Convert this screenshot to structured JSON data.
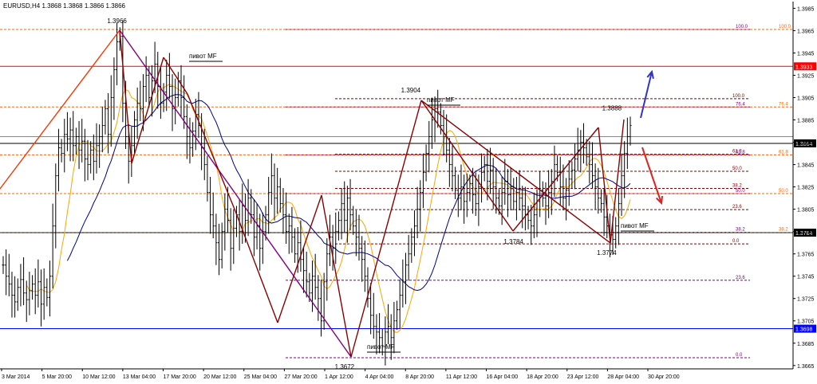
{
  "title": "EURUSD,H4  1.3868 1.3868 1.3866 1.3866",
  "chart_data": {
    "type": "line",
    "symbol": "EURUSD",
    "timeframe": "H4",
    "ohlc_header": [
      1.3868,
      1.3868,
      1.3866,
      1.3866
    ],
    "ylim": [
      1.3662,
      1.3991
    ],
    "y_ticks": [
      1.3985,
      1.3965,
      1.3945,
      1.3925,
      1.3905,
      1.3885,
      1.3865,
      1.3845,
      1.3825,
      1.3805,
      1.3785,
      1.3765,
      1.3745,
      1.3725,
      1.3705,
      1.3685,
      1.3665
    ],
    "x_ticks": [
      "3 Mar 2014",
      "5 Mar 20:00",
      "10 Mar 12:00",
      "13 Mar 04:00",
      "17 Mar 20:00",
      "20 Mar 12:00",
      "25 Mar 04:00",
      "27 Mar 20:00",
      "1 Apr 12:00",
      "4 Apr 04:00",
      "8 Apr 20:00",
      "11 Apr 12:00",
      "16 Apr 04:00",
      "18 Apr 20:00",
      "23 Apr 12:00",
      "28 Apr 04:00",
      "30 Apr 20:00"
    ],
    "price_series": {
      "name": "",
      "color": "#000000",
      "x": [
        0,
        1,
        2,
        3,
        4,
        5,
        6,
        7,
        8,
        9,
        10,
        11,
        12,
        13,
        14,
        15,
        16,
        17,
        18,
        19,
        20,
        21,
        22,
        23,
        24,
        25,
        26,
        27,
        28,
        29,
        30,
        31,
        32,
        33,
        34,
        35,
        36,
        37,
        38,
        39,
        40,
        41,
        42,
        43,
        44,
        45,
        46,
        47,
        48,
        49,
        50,
        51,
        52,
        53,
        54,
        55,
        56,
        57,
        58,
        59,
        60,
        61,
        62,
        63,
        64,
        65,
        66,
        67,
        68,
        69,
        70,
        71,
        72,
        73,
        74,
        75,
        76,
        77,
        78,
        79,
        80,
        81,
        82,
        83,
        84,
        85,
        86,
        87,
        88,
        89,
        90,
        91,
        92,
        93,
        94,
        95,
        96,
        97,
        98,
        99,
        100,
        101,
        102,
        103,
        104,
        105,
        106,
        107,
        108,
        109,
        110,
        111,
        112,
        113,
        114,
        115,
        116,
        117,
        118,
        119,
        120,
        121,
        122,
        123,
        124,
        125,
        126,
        127,
        128,
        129,
        130,
        131,
        132,
        133,
        134,
        135,
        136,
        137,
        138,
        139,
        140,
        141,
        142,
        143,
        144,
        145,
        146,
        147,
        148,
        149,
        150,
        151,
        152,
        153,
        154,
        155,
        156,
        157,
        158,
        159,
        160,
        161,
        162,
        163,
        164,
        165,
        166,
        167,
        168,
        169,
        170,
        171,
        172,
        173,
        174,
        175,
        176,
        177,
        178,
        179,
        180,
        181,
        182,
        183,
        184,
        185,
        186,
        187,
        188,
        189,
        190,
        191,
        192,
        193,
        194,
        195,
        196,
        197,
        198,
        199,
        200,
        201,
        202,
        203,
        204,
        205,
        206,
        207,
        208,
        209,
        210,
        211,
        212,
        213,
        214,
        215,
        216,
        217,
        218,
        219,
        220,
        221,
        222,
        223,
        224,
        225,
        226,
        227,
        228,
        229,
        230,
        231,
        232,
        233,
        234,
        235,
        236,
        237,
        238,
        239,
        240,
        241,
        242,
        243,
        244,
        245,
        246,
        247,
        248,
        249,
        250,
        251,
        252,
        253,
        254,
        255,
        256,
        257,
        258,
        259,
        260
      ],
      "y": [
        1.3755,
        1.3745,
        1.3738,
        1.3728,
        1.3722,
        1.3735,
        1.3742,
        1.373,
        1.3724,
        1.3732,
        1.3738,
        1.3728,
        1.374,
        1.372,
        1.3735,
        1.3726,
        1.3745,
        1.379,
        1.3835,
        1.386,
        1.3855,
        1.3872,
        1.3868,
        1.3876,
        1.3862,
        1.387,
        1.3858,
        1.3866,
        1.385,
        1.3845,
        1.3858,
        1.3848,
        1.3862,
        1.387,
        1.388,
        1.3895,
        1.3872,
        1.3905,
        1.393,
        1.3955,
        1.396,
        1.39,
        1.387,
        1.3848,
        1.3862,
        1.3885,
        1.39,
        1.3895,
        1.3915,
        1.3925,
        1.3905,
        1.392,
        1.3935,
        1.3915,
        1.39,
        1.391,
        1.3925,
        1.3915,
        1.3895,
        1.3905,
        1.392,
        1.3905,
        1.3888,
        1.387,
        1.386,
        1.3875,
        1.389,
        1.388,
        1.386,
        1.3845,
        1.382,
        1.38,
        1.379,
        1.3775,
        1.376,
        1.3785,
        1.3805,
        1.3795,
        1.377,
        1.3788,
        1.38,
        1.3785,
        1.3808,
        1.3795,
        1.3815,
        1.38,
        1.378,
        1.379,
        1.377,
        1.3785,
        1.38,
        1.382,
        1.3835,
        1.3815,
        1.3825,
        1.381,
        1.38,
        1.3785,
        1.379,
        1.378,
        1.3765,
        1.3775,
        1.376,
        1.375,
        1.374,
        1.373,
        1.3745,
        1.3735,
        1.3725,
        1.3705,
        1.374,
        1.3765,
        1.378,
        1.377,
        1.3785,
        1.3795,
        1.381,
        1.3795,
        1.3815,
        1.38,
        1.379,
        1.378,
        1.377,
        1.376,
        1.3745,
        1.3725,
        1.371,
        1.37,
        1.3695,
        1.369,
        1.3682,
        1.3695,
        1.37,
        1.369,
        1.3705,
        1.3715,
        1.3728,
        1.374,
        1.3755,
        1.3765,
        1.378,
        1.379,
        1.3805,
        1.382,
        1.3838,
        1.3855,
        1.387,
        1.3885,
        1.3895,
        1.3892,
        1.388,
        1.387,
        1.3858,
        1.3845,
        1.3835,
        1.3822,
        1.3815,
        1.3825,
        1.3812,
        1.382,
        1.3828,
        1.3818,
        1.381,
        1.3825,
        1.3838,
        1.3845,
        1.383,
        1.384,
        1.3825,
        1.3815,
        1.3808,
        1.382,
        1.383,
        1.3818,
        1.3825,
        1.3812,
        1.382,
        1.3815,
        1.3808,
        1.38,
        1.3795,
        1.379,
        1.38,
        1.3812,
        1.3822,
        1.3815,
        1.3808,
        1.382,
        1.383,
        1.3845,
        1.3838,
        1.3825,
        1.3815,
        1.3822,
        1.3832,
        1.384,
        1.385,
        1.3858,
        1.3865,
        1.386,
        1.3852,
        1.3845,
        1.3835,
        1.3825,
        1.3815,
        1.381,
        1.3798,
        1.379,
        1.3782,
        1.3778,
        1.379,
        1.381,
        1.3835,
        1.3855,
        1.387,
        1.388,
        1.3875,
        1.3865,
        1.3868,
        1.387,
        1.3866,
        1.3866,
        1.3866,
        1.3866,
        1.3866,
        1.3866,
        1.3866,
        1.3866,
        1.3866,
        1.3866,
        1.3866,
        1.3866,
        1.3866,
        1.3866,
        1.3866,
        1.3866,
        1.3866,
        1.3866,
        1.3866,
        1.3866,
        1.3866,
        1.3866,
        1.3866,
        1.3866,
        1.3866,
        1.3866,
        1.3866,
        1.3866,
        1.3866,
        1.3866,
        1.3866,
        1.3866,
        1.3866,
        1.3866,
        1.3866,
        1.3866,
        1.3866
      ]
    },
    "swing_points": [
      {
        "label": "1.3966",
        "x": 0.1475,
        "y": 1.3966
      },
      {
        "label": "1.3904",
        "x": 0.518,
        "y": 1.3904
      },
      {
        "label": "1.3888",
        "x": 0.7715,
        "y": 1.3888
      },
      {
        "label": "1.3784",
        "x": 0.6475,
        "y": 1.3784
      },
      {
        "label": "1.3774",
        "x": 0.765,
        "y": 1.3774
      },
      {
        "label": "1.3672",
        "x": 0.4345,
        "y": 1.3672
      }
    ],
    "pivot_labels": [
      "пивот MF",
      "пивот MF",
      "пивот MF",
      "пивот MF"
    ],
    "horizontal_levels": [
      {
        "price": 1.3933,
        "label": "1.3933",
        "color": "#ff0000"
      },
      {
        "price": 1.3864,
        "label": "1.3864",
        "color": "#000000"
      },
      {
        "price": 1.3784,
        "label": "1.3784",
        "color": "#000000"
      },
      {
        "price": 1.3698,
        "label": "1.3698",
        "color": "#0000ff"
      }
    ],
    "fibo_sets": [
      {
        "color": "#800080",
        "levels": [
          "100.0",
          "76.4",
          "61.8",
          "50.0",
          "38.2",
          "23.6",
          "0.0"
        ]
      },
      {
        "color": "#800000",
        "levels": [
          "100.0",
          "61.8",
          "50.0",
          "38.2",
          "23.6",
          "0.0"
        ]
      },
      {
        "color": "#ff6600",
        "levels": [
          "100.0",
          "76.4",
          "61.8",
          "50.0",
          "38.2"
        ]
      }
    ],
    "colors": {
      "wave": "#8b0000",
      "trend_up": "#ff3300",
      "trend_down": "#800080",
      "ma_fast": "#ffa500",
      "ma_slow": "#00008b",
      "arrow_up": "#3333cc",
      "arrow_down": "#dd2222"
    },
    "grid": false,
    "legend": "none"
  }
}
